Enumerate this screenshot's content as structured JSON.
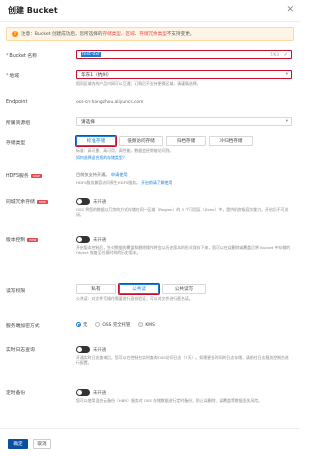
{
  "header": {
    "title": "创建 Bucket",
    "close_icon": "close-icon"
  },
  "notice": {
    "prefix": "注意：Bucket 创建成功后，您所选择的",
    "highlight": "存储类型、区域、存储冗余类型",
    "suffix": "不支持变更。"
  },
  "bucket_name": {
    "label": "Bucket 名称",
    "value": "test-0xf",
    "counter": "7/63"
  },
  "region": {
    "label": "地域",
    "value": "华东1（杭州）"
  },
  "region_hint": "相同区域内的产品内网可以互通；订购后不支持更换区域，请谨慎选择。",
  "endpoint": {
    "label": "Endpoint",
    "value": "oss-cn-hangzhou.aliyuncs.com"
  },
  "resource_group": {
    "label": "所属资源组",
    "value": "请选择"
  },
  "storage_class": {
    "label": "存储类型",
    "options": [
      "标准存储",
      "低频访问存储",
      "归档存储",
      "冷归档存储"
    ],
    "selected": "标准存储",
    "desc": "标准：高可靠、高可用、高性能，数据会经常被访问到。",
    "link": "如何选择适合您的存储类型？"
  },
  "hdfs": {
    "label": "HDFS服务",
    "badge": "new",
    "status": "目前仅支持开通。",
    "apply": "申请使用",
    "desc": "HDFS服务兼容访问原生HDFS服务。",
    "doc": "开启前请了解使用"
  },
  "redundancy": {
    "label": "同城冗余存储",
    "badge": "new",
    "toggle": "未开通",
    "desc": "OSS 将您的数据以冗余的方式存储在同一区域（Region）的 3 个可用区（Zone）中，提供机房级容灾能力。开启后不可关闭，"
  },
  "versioning": {
    "label": "版本控制",
    "badge": "new",
    "toggle": "未开通",
    "desc": "开启版本控制后，针对数据的覆盖和删除操作将会以历史版本的形式保存下来，您可以在误删除或覆盖后将 Bucket 中存储的 Object 恢复至任意时刻的历史版本。"
  },
  "acl": {
    "label": "读写权限",
    "options": [
      "私有",
      "公共读",
      "公共读写"
    ],
    "selected": "公共读",
    "desc": "公共读：对文件写操作需要进行身份验证；可以对文件进行匿名读。"
  },
  "encryption": {
    "label": "服务端加密方式",
    "options": [
      "无",
      "OSS 完全托管",
      "KMS"
    ],
    "selected": "无"
  },
  "log_query": {
    "label": "实时日志查询",
    "toggle": "未开通",
    "desc": "开通实时日志查询后，您可以在控制台实时查询OSS访问日志（7天）。如需更长时间的日志存储，请前往日志服务控制台进行配置。"
  },
  "scheduled_backup": {
    "label": "定时备份",
    "toggle": "未开通",
    "desc": "您可以使用混合云备份（HBR）服务对 OSS 存储数据进行定时备份，防止误删除、误覆盖等数据丢失风险。"
  },
  "footer": {
    "confirm": "确定",
    "cancel": "取消"
  }
}
